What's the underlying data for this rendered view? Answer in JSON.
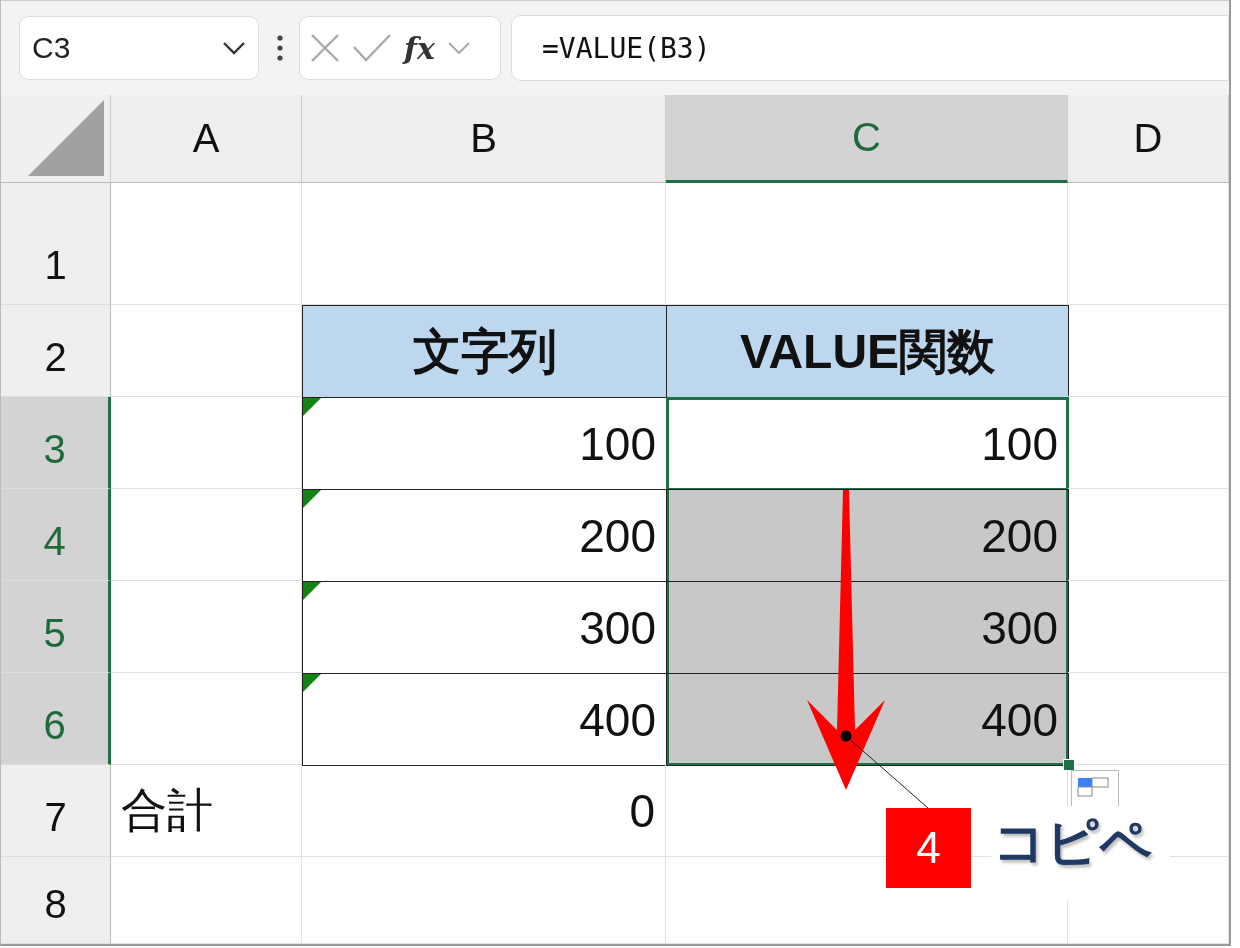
{
  "formula_bar": {
    "name_box": "C3",
    "fx_label": "fx",
    "formula": "=VALUE(B3)"
  },
  "columns": [
    {
      "label": "A",
      "selected": false
    },
    {
      "label": "B",
      "selected": false
    },
    {
      "label": "C",
      "selected": true
    },
    {
      "label": "D",
      "selected": false
    }
  ],
  "rows": [
    {
      "label": "1",
      "selected": false,
      "cells": [
        {
          "kind": "empty",
          "bordered": false,
          "selected": false,
          "active": false,
          "error_flag": false
        },
        {
          "kind": "empty",
          "bordered": false,
          "selected": false,
          "active": false,
          "error_flag": false
        },
        {
          "kind": "empty",
          "bordered": false,
          "selected": false,
          "active": false,
          "error_flag": false
        },
        {
          "kind": "empty",
          "bordered": false,
          "selected": false,
          "active": false,
          "error_flag": false
        }
      ]
    },
    {
      "label": "2",
      "selected": false,
      "cells": [
        {
          "kind": "empty",
          "bordered": false,
          "selected": false,
          "active": false,
          "error_flag": false
        },
        {
          "kind": "header",
          "text": "文字列",
          "bordered": true,
          "selected": false,
          "active": false,
          "error_flag": false
        },
        {
          "kind": "header",
          "text": "VALUE関数",
          "bordered": true,
          "selected": false,
          "active": false,
          "error_flag": false
        },
        {
          "kind": "empty",
          "bordered": false,
          "selected": false,
          "active": false,
          "error_flag": false
        }
      ]
    },
    {
      "label": "3",
      "selected": true,
      "cells": [
        {
          "kind": "empty",
          "bordered": false,
          "selected": false,
          "active": false,
          "error_flag": false
        },
        {
          "kind": "number",
          "text": "100",
          "bordered": true,
          "selected": false,
          "active": false,
          "error_flag": true
        },
        {
          "kind": "number",
          "text": "100",
          "bordered": true,
          "selected": true,
          "active": true,
          "error_flag": false
        },
        {
          "kind": "empty",
          "bordered": false,
          "selected": false,
          "active": false,
          "error_flag": false
        }
      ]
    },
    {
      "label": "4",
      "selected": true,
      "cells": [
        {
          "kind": "empty",
          "bordered": false,
          "selected": false,
          "active": false,
          "error_flag": false
        },
        {
          "kind": "number",
          "text": "200",
          "bordered": true,
          "selected": false,
          "active": false,
          "error_flag": true
        },
        {
          "kind": "number",
          "text": "200",
          "bordered": true,
          "selected": true,
          "active": false,
          "error_flag": false
        },
        {
          "kind": "empty",
          "bordered": false,
          "selected": false,
          "active": false,
          "error_flag": false
        }
      ]
    },
    {
      "label": "5",
      "selected": true,
      "cells": [
        {
          "kind": "empty",
          "bordered": false,
          "selected": false,
          "active": false,
          "error_flag": false
        },
        {
          "kind": "number",
          "text": "300",
          "bordered": true,
          "selected": false,
          "active": false,
          "error_flag": true
        },
        {
          "kind": "number",
          "text": "300",
          "bordered": true,
          "selected": true,
          "active": false,
          "error_flag": false
        },
        {
          "kind": "empty",
          "bordered": false,
          "selected": false,
          "active": false,
          "error_flag": false
        }
      ]
    },
    {
      "label": "6",
      "selected": true,
      "cells": [
        {
          "kind": "empty",
          "bordered": false,
          "selected": false,
          "active": false,
          "error_flag": false
        },
        {
          "kind": "number",
          "text": "400",
          "bordered": true,
          "selected": false,
          "active": false,
          "error_flag": true
        },
        {
          "kind": "number",
          "text": "400",
          "bordered": true,
          "selected": true,
          "active": false,
          "error_flag": false
        },
        {
          "kind": "empty",
          "bordered": false,
          "selected": false,
          "active": false,
          "error_flag": false
        }
      ]
    },
    {
      "label": "7",
      "selected": false,
      "cells": [
        {
          "kind": "text",
          "text": "合計",
          "bordered": false,
          "selected": false,
          "active": false,
          "error_flag": false
        },
        {
          "kind": "number",
          "text": "0",
          "bordered": false,
          "selected": false,
          "active": false,
          "error_flag": false
        },
        {
          "kind": "empty",
          "bordered": false,
          "selected": false,
          "active": false,
          "error_flag": false
        },
        {
          "kind": "empty",
          "bordered": false,
          "selected": false,
          "active": false,
          "error_flag": false
        }
      ]
    },
    {
      "label": "8",
      "selected": false,
      "cells": [
        {
          "kind": "empty",
          "bordered": false,
          "selected": false,
          "active": false,
          "error_flag": false
        },
        {
          "kind": "empty",
          "bordered": false,
          "selected": false,
          "active": false,
          "error_flag": false
        },
        {
          "kind": "empty",
          "bordered": false,
          "selected": false,
          "active": false,
          "error_flag": false
        },
        {
          "kind": "empty",
          "bordered": false,
          "selected": false,
          "active": false,
          "error_flag": false
        }
      ]
    }
  ],
  "annotation": {
    "step": "4",
    "caption": "コピペ"
  }
}
